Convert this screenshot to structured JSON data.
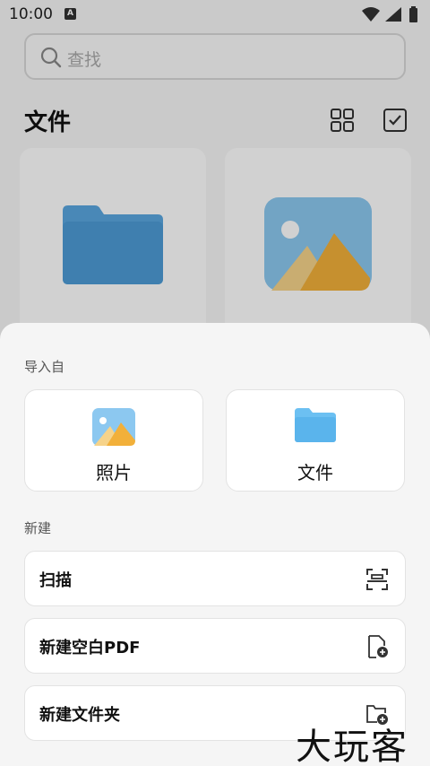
{
  "status_bar": {
    "time": "10:00",
    "notification_badge": "A"
  },
  "search": {
    "placeholder": "查找"
  },
  "header": {
    "title": "文件"
  },
  "sheet": {
    "import_label": "导入自",
    "import_options": [
      {
        "label": "照片",
        "icon": "photo-icon"
      },
      {
        "label": "文件",
        "icon": "folder-icon"
      }
    ],
    "new_label": "新建",
    "new_items": [
      {
        "label": "扫描",
        "icon": "scan-icon"
      },
      {
        "label": "新建空白PDF",
        "icon": "new-pdf-icon"
      },
      {
        "label": "新建文件夹",
        "icon": "new-folder-icon"
      }
    ]
  },
  "watermark": "大玩客",
  "colors": {
    "folder_blue": "#5aa7e0",
    "photo_sky": "#8cc8f0",
    "photo_mountain": "#f2b03a"
  }
}
